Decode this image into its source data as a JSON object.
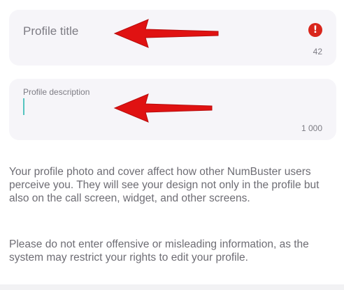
{
  "profile_title_field": {
    "placeholder": "Profile title",
    "counter": "42",
    "error_icon": "exclamation-icon",
    "error_color": "#d9261c"
  },
  "profile_description_field": {
    "label": "Profile description",
    "counter": "1 000",
    "caret_color": "#55c4c0"
  },
  "info": {
    "paragraph_1": "Your profile photo and cover affect how other NumBuster users perceive you. They will see your design not only in the profile but also on the call screen, widget, and other screens.",
    "paragraph_2": "Please do not enter offensive or misleading information, as the system may restrict your rights to edit your profile."
  },
  "annotation_arrow_color": "#e01212"
}
